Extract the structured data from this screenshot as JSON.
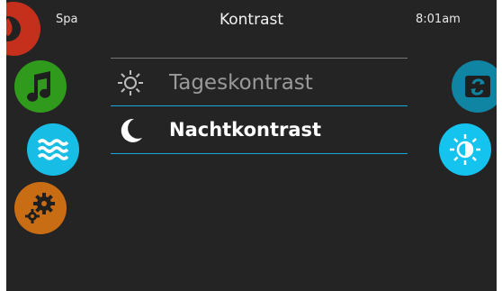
{
  "header": {
    "location_label": "Spa",
    "title": "Kontrast",
    "time": "8:01am"
  },
  "menu": {
    "items": [
      {
        "label": "Tageskontrast",
        "icon": "sun-icon",
        "selected": false
      },
      {
        "label": "Nachtkontrast",
        "icon": "moon-icon",
        "selected": true
      }
    ]
  },
  "left_icons": [
    {
      "name": "spa-home-icon",
      "color": "#c4301c"
    },
    {
      "name": "music-icon",
      "color": "#2f9a1c"
    },
    {
      "name": "water-icon",
      "color": "#18bde6"
    },
    {
      "name": "settings-gears-icon",
      "color": "#c96d14"
    }
  ],
  "right_icons": [
    {
      "name": "flip-icon",
      "color": "#0f84a3"
    },
    {
      "name": "contrast-icon",
      "color": "#14c3ee"
    }
  ],
  "colors": {
    "background": "#242424",
    "accent_line": "#1aa8d8",
    "inactive_text": "#9a9a9a",
    "active_text": "#ffffff"
  }
}
